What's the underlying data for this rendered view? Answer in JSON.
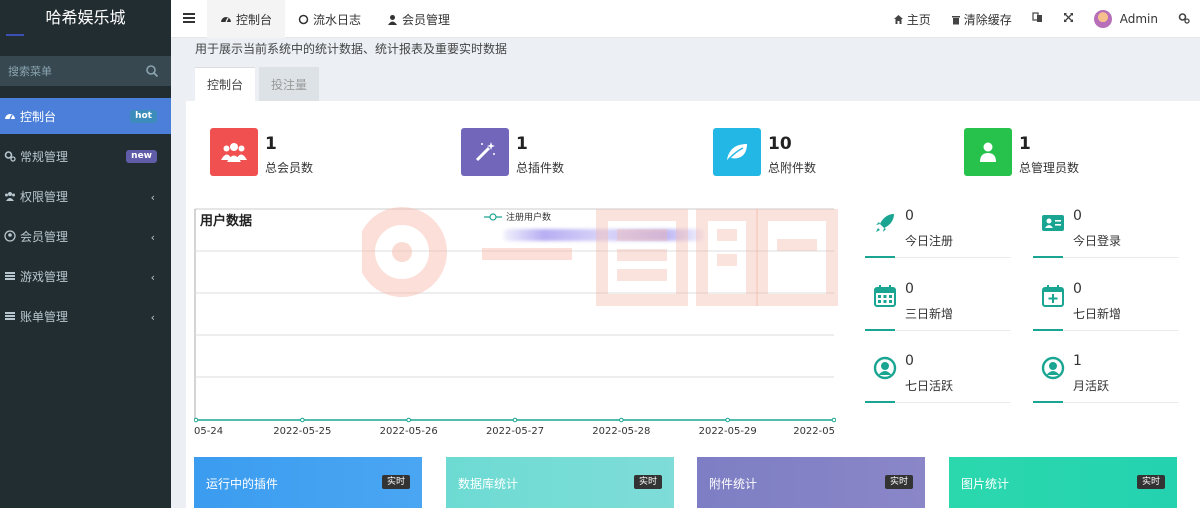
{
  "app": {
    "title": "哈希娱乐城"
  },
  "search": {
    "placeholder": "搜索菜单"
  },
  "sidebar": {
    "items": [
      {
        "label": "控制台",
        "badge": "hot"
      },
      {
        "label": "常规管理",
        "badge": "new"
      },
      {
        "label": "权限管理"
      },
      {
        "label": "会员管理"
      },
      {
        "label": "游戏管理"
      },
      {
        "label": "账单管理"
      }
    ]
  },
  "topnav": {
    "tabs": [
      {
        "label": "控制台"
      },
      {
        "label": "流水日志"
      },
      {
        "label": "会员管理"
      }
    ],
    "home": "主页",
    "clear_cache": "清除缓存",
    "user": "Admin"
  },
  "content": {
    "subtitle": "用于展示当前系统中的统计数据、统计报表及重要实时数据",
    "tabs": [
      {
        "label": "控制台"
      },
      {
        "label": "投注量"
      }
    ]
  },
  "stats": [
    {
      "value": "1",
      "label": "总会员数",
      "color": "#f05050",
      "icon": "users-icon"
    },
    {
      "value": "1",
      "label": "总插件数",
      "color": "#7266ba",
      "icon": "magic-icon"
    },
    {
      "value": "10",
      "label": "总附件数",
      "color": "#23b7e5",
      "icon": "leaf-icon"
    },
    {
      "value": "1",
      "label": "总管理员数",
      "color": "#27c24c",
      "icon": "user-icon"
    }
  ],
  "chart_data": {
    "type": "line",
    "title": "用户数据",
    "series": [
      {
        "name": "注册用户数",
        "values": [
          0,
          0,
          0,
          0,
          0,
          0,
          0
        ]
      }
    ],
    "categories": [
      "05-24",
      "2022-05-25",
      "2022-05-26",
      "2022-05-27",
      "2022-05-28",
      "2022-05-29",
      "2022-05"
    ],
    "legend": "top",
    "grid": true,
    "line_color": "#1aa592"
  },
  "mini_stats": [
    {
      "value": "0",
      "label": "今日注册",
      "icon": "rocket-icon"
    },
    {
      "value": "0",
      "label": "今日登录",
      "icon": "id-card-icon"
    },
    {
      "value": "0",
      "label": "三日新增",
      "icon": "calendar-icon"
    },
    {
      "value": "0",
      "label": "七日新增",
      "icon": "calendar-plus-icon"
    },
    {
      "value": "0",
      "label": "七日活跃",
      "icon": "user-circle-icon"
    },
    {
      "value": "1",
      "label": "月活跃",
      "icon": "user-circle-icon"
    }
  ],
  "cards": [
    {
      "title": "运行中的插件",
      "tag": "实时"
    },
    {
      "title": "数据库统计",
      "tag": "实时"
    },
    {
      "title": "附件统计",
      "tag": "实时"
    },
    {
      "title": "图片统计",
      "tag": "实时"
    }
  ]
}
